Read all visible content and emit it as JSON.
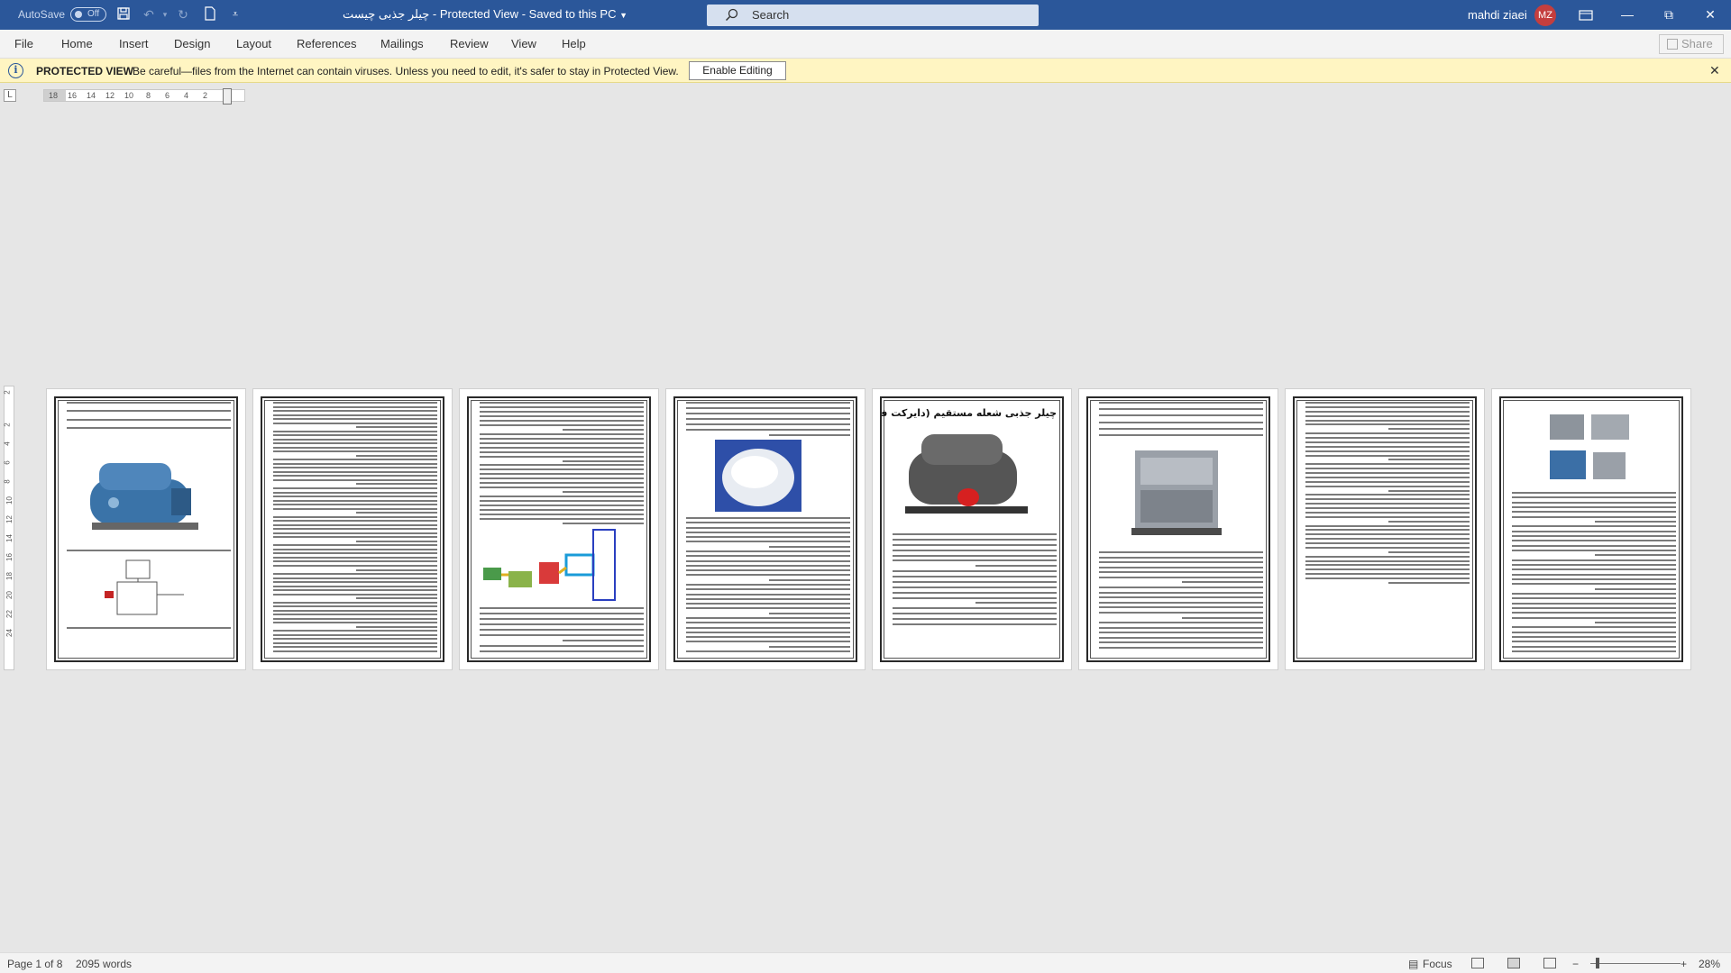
{
  "titlebar": {
    "autosave_label": "AutoSave",
    "autosave_state": "Off",
    "document_name": "چیلر جذبی چیست",
    "mode": "Protected View",
    "save_status": "Saved to this PC",
    "search_placeholder": "Search",
    "user_name": "mahdi ziaei",
    "user_initials": "MZ"
  },
  "ribbon": {
    "tabs": [
      "File",
      "Home",
      "Insert",
      "Design",
      "Layout",
      "References",
      "Mailings",
      "Review",
      "View",
      "Help"
    ],
    "share_label": "Share"
  },
  "protected_view": {
    "title": "PROTECTED VIEW",
    "message": "Be careful—files from the Internet can contain viruses. Unless you need to edit, it's safer to stay in Protected View.",
    "button_label": "Enable Editing"
  },
  "ruler": {
    "corner": "L",
    "horizontal_numbers": [
      "18",
      "16",
      "14",
      "12",
      "10",
      "8",
      "6",
      "4",
      "2"
    ],
    "vertical_numbers": [
      "2",
      "2",
      "4",
      "6",
      "8",
      "10",
      "12",
      "14",
      "16",
      "18",
      "20",
      "22",
      "24"
    ]
  },
  "pages": [
    {
      "heading": ""
    },
    {
      "heading": ""
    },
    {
      "heading": ""
    },
    {
      "heading": ""
    },
    {
      "heading": "چیلر جذبی شعله مستقیم (دایرکت فایر)"
    },
    {
      "heading": ""
    },
    {
      "heading": ""
    },
    {
      "heading": ""
    }
  ],
  "status": {
    "page_info": "Page 1 of 8",
    "word_count": "2095 words",
    "focus_label": "Focus",
    "zoom_minus": "−",
    "zoom_plus": "+",
    "zoom_level": "28%"
  },
  "colors": {
    "titlebar": "#2b579a",
    "protected_bar": "#fff5c2",
    "avatar": "#c43e3e"
  }
}
